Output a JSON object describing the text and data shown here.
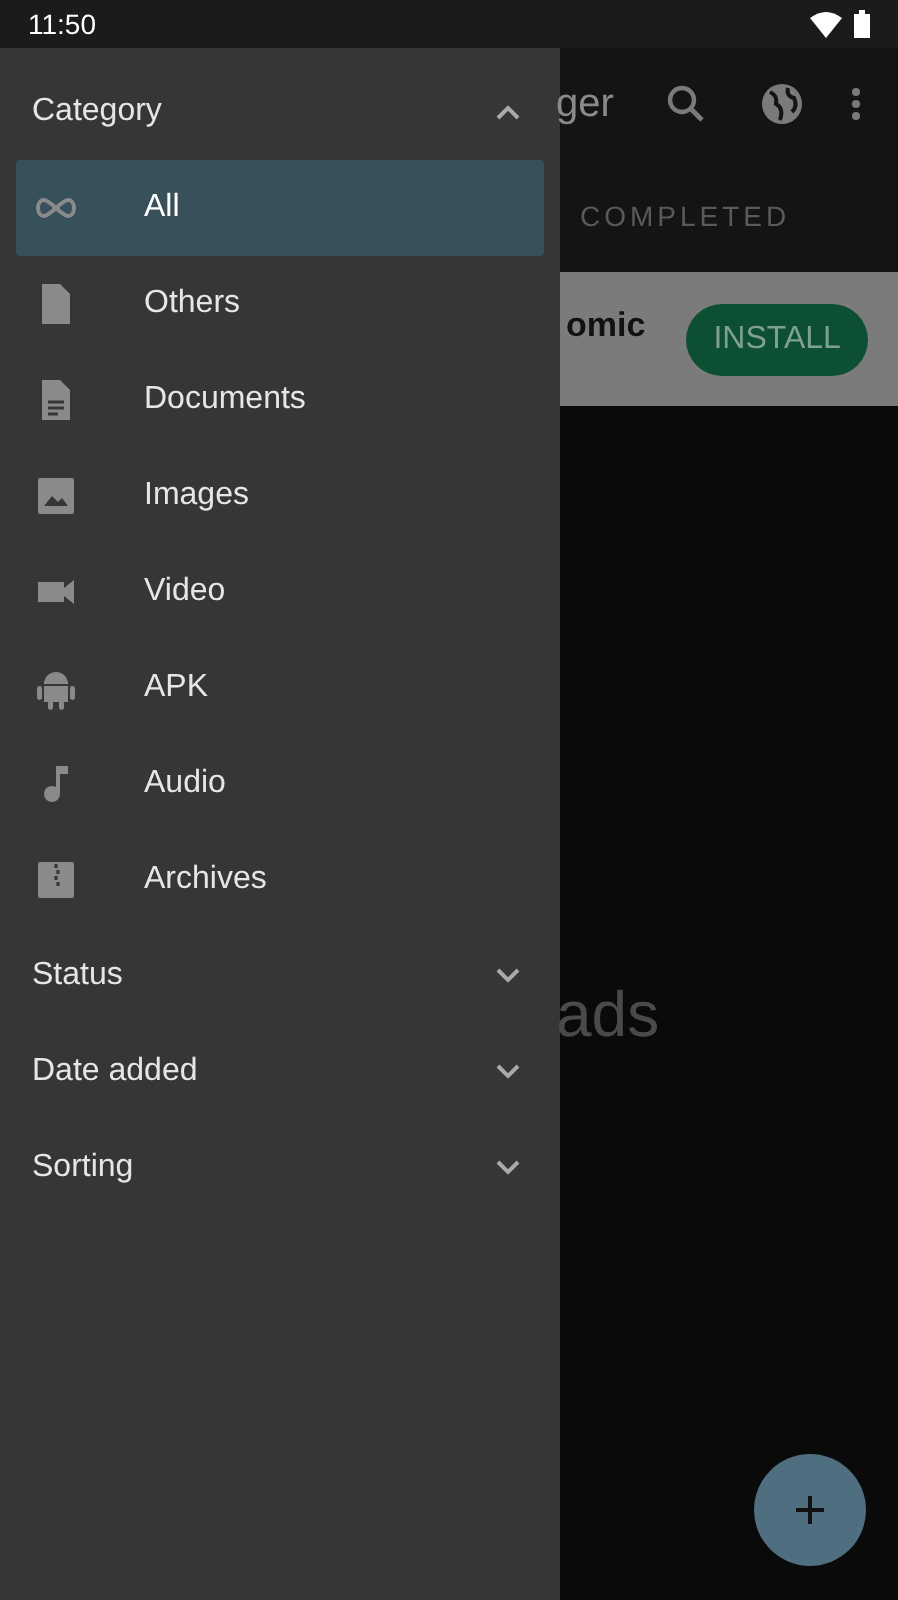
{
  "status_bar": {
    "time": "11:50"
  },
  "drawer": {
    "sections": [
      {
        "title": "Category",
        "expanded": true,
        "items": [
          {
            "label": "All",
            "selected": true
          },
          {
            "label": "Others",
            "selected": false
          },
          {
            "label": "Documents",
            "selected": false
          },
          {
            "label": "Images",
            "selected": false
          },
          {
            "label": "Video",
            "selected": false
          },
          {
            "label": "APK",
            "selected": false
          },
          {
            "label": "Audio",
            "selected": false
          },
          {
            "label": "Archives",
            "selected": false
          }
        ]
      },
      {
        "title": "Status",
        "expanded": false
      },
      {
        "title": "Date added",
        "expanded": false
      },
      {
        "title": "Sorting",
        "expanded": false
      }
    ]
  },
  "background": {
    "app_bar_title": "ger",
    "tabs": [
      {
        "label": "COMPLETED",
        "selected": false
      }
    ],
    "card": {
      "title": "omic",
      "button": "INSTALL"
    },
    "empty_message": "ads"
  }
}
